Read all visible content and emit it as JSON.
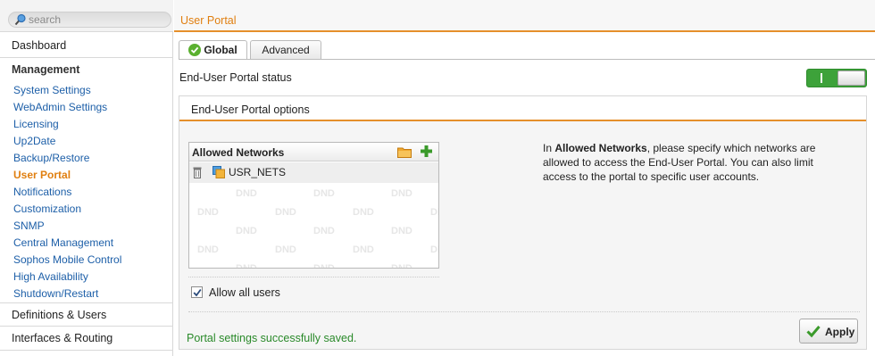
{
  "search": {
    "placeholder": "search"
  },
  "sidebar": {
    "dashboard": "Dashboard",
    "management_heading": "Management",
    "management_items": [
      {
        "label": "System Settings"
      },
      {
        "label": "WebAdmin Settings"
      },
      {
        "label": "Licensing"
      },
      {
        "label": "Up2Date"
      },
      {
        "label": "Backup/Restore"
      },
      {
        "label": "User Portal"
      },
      {
        "label": "Notifications"
      },
      {
        "label": "Customization"
      },
      {
        "label": "SNMP"
      },
      {
        "label": "Central Management"
      },
      {
        "label": "Sophos Mobile Control"
      },
      {
        "label": "High Availability"
      },
      {
        "label": "Shutdown/Restart"
      }
    ],
    "active_item": "User Portal",
    "definitions": "Definitions & Users",
    "interfaces": "Interfaces & Routing"
  },
  "main": {
    "title": "User Portal",
    "tabs": [
      {
        "label": "Global",
        "active": true,
        "icon": "check-circle-icon"
      },
      {
        "label": "Advanced",
        "active": false
      }
    ],
    "status_label": "End-User Portal status",
    "status_enabled": true,
    "options_title": "End-User Portal options",
    "allowed_networks": {
      "title": "Allowed Networks",
      "items": [
        {
          "name": "USR_NETS",
          "icon": "network-object-icon"
        }
      ],
      "placeholder_word": "DND"
    },
    "allow_all_users": {
      "label": "Allow all users",
      "checked": true
    },
    "help": {
      "prefix": "In ",
      "bold": "Allowed Networks",
      "suffix": ", please specify which networks are allowed to access the End-User Portal. You can also limit access to the portal to specific user accounts."
    },
    "saved_message": "Portal settings successfully saved.",
    "apply_label": "Apply"
  },
  "colors": {
    "accent": "#e58f2b",
    "link": "#1d5fa8",
    "active": "#e07f10",
    "toggle_on": "#3da23a",
    "success": "#2a8a2a"
  }
}
